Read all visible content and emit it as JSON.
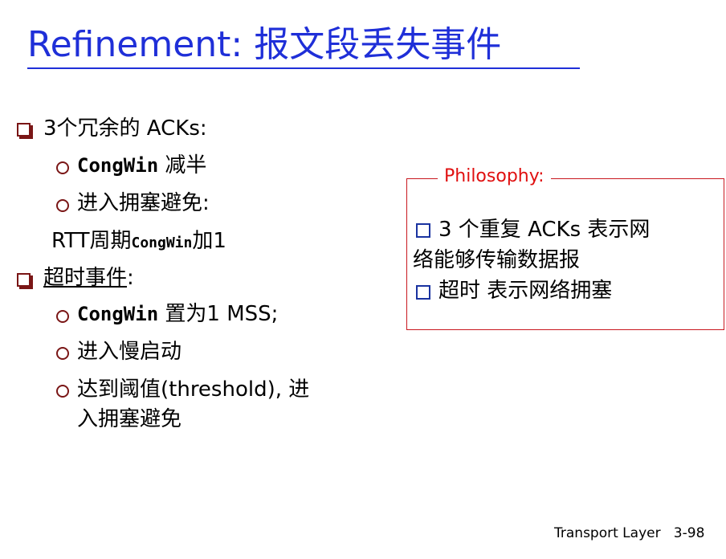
{
  "slide": {
    "title": "Refinement: 报文段丢失事件",
    "items": {
      "a": "3个冗余的 ACKs:",
      "a1_code": "CongWin",
      "a1_text": " 减半",
      "a2": "进入拥塞避免:",
      "a3_pre": "RTT周期",
      "a3_code": "CongWin",
      "a3_post": "加1",
      "b_u": "超时事件",
      "b_colon": ":",
      "b1_code": "CongWin",
      "b1_text": " 置为1 MSS;",
      "b2": "进入慢启动",
      "b3_l1": "达到阈值(threshold), 进",
      "b3_l2": "入拥塞避免"
    },
    "philosophy": {
      "label": "Philosophy:",
      "l1": "3 个重复 ACKs  表示网",
      "l2": "络能够传输数据报",
      "l3": "超时 表示网络拥塞"
    },
    "footer": {
      "section": "Transport Layer",
      "page": "3-98"
    }
  }
}
